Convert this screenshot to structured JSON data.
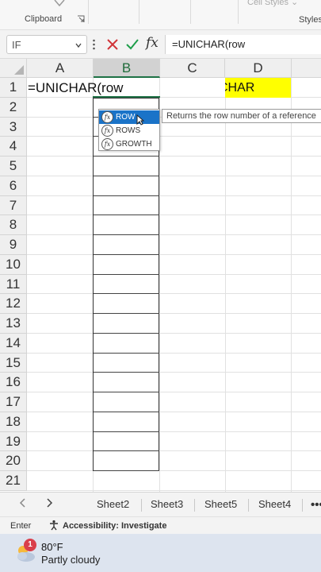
{
  "ribbon": {
    "clipboard_label": "Clipboard",
    "cell_styles_label": "Cell Styles",
    "styles_label": "Styles"
  },
  "formula_bar": {
    "name_box": "IF",
    "formula": "=UNICHAR(row"
  },
  "columns": [
    "A",
    "B",
    "C",
    "D"
  ],
  "rows": [
    "1",
    "2",
    "3",
    "4",
    "5",
    "6",
    "7",
    "8",
    "9",
    "10",
    "11",
    "12",
    "13",
    "14",
    "15",
    "16",
    "17",
    "18",
    "19",
    "20",
    "21"
  ],
  "cells": {
    "A1": "=UNICHAR(row",
    "D1": "CHAR"
  },
  "autocomplete": {
    "items": [
      {
        "icon": "fx",
        "label": "ROW"
      },
      {
        "icon": "fx",
        "label": "ROWS"
      },
      {
        "icon": "fx",
        "label": "GROWTH"
      }
    ],
    "tooltip": "Returns the row number of a reference"
  },
  "sheet_tabs": [
    "Sheet2",
    "Sheet3",
    "Sheet5",
    "Sheet4"
  ],
  "sheet_tabs_more": "•••",
  "status": {
    "mode": "Enter",
    "accessibility": "Accessibility: Investigate"
  },
  "taskbar": {
    "badge": "1",
    "temperature": "80°F",
    "condition": "Partly cloudy"
  },
  "colors": {
    "accent": "#1e7145",
    "selection": "#1a73c8",
    "highlight": "#ffff00"
  }
}
